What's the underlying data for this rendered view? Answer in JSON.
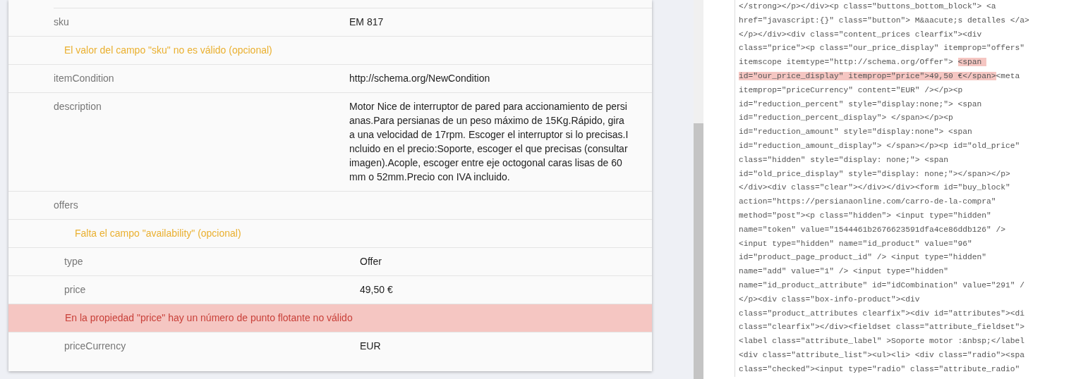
{
  "results": [
    {
      "kind": "property",
      "label": "sku",
      "value": "EM 817"
    },
    {
      "kind": "warning",
      "message": "El valor del campo \"sku\" no es válido (opcional)"
    },
    {
      "kind": "property",
      "label": "itemCondition",
      "value": "http://schema.org/NewCondition"
    },
    {
      "kind": "property",
      "label": "description",
      "value": "Motor Nice de interruptor de pared para accionamiento de persianas.Para persianas de un peso máximo de 15Kg.Rápido, gira a una velocidad de 17rpm. Escoger el interruptor si lo precisas.Incluido en el precio:Soporte, escoger el que precisas (consultar imagen).Acople, escoger entre eje octogonal caras lisas de 60mm o 52mm.Precio con IVA incluido."
    },
    {
      "kind": "property",
      "label": "offers",
      "children": [
        {
          "kind": "warning",
          "message": "Falta el campo \"availability\" (opcional)"
        },
        {
          "kind": "property",
          "label": "type",
          "value": "Offer"
        },
        {
          "kind": "property",
          "label": "price",
          "value": "49,50 €"
        },
        {
          "kind": "error",
          "message": "En la propiedad \"price\" hay un número de punto flotante no válido"
        },
        {
          "kind": "property",
          "label": "priceCurrency",
          "value": "EUR"
        }
      ]
    }
  ],
  "source_code": [
    [
      {
        "text": "</strong></p></div><p class=\"buttons_bottom_block\"> <a",
        "highlighted": false
      }
    ],
    [
      {
        "text": "href=\"javascript:{}\" class=\"button\"> M&aacute;s detalles </a>",
        "highlighted": false
      }
    ],
    [
      {
        "text": "</p></div><div class=\"content_prices clearfix\"><div",
        "highlighted": false
      }
    ],
    [
      {
        "text": "class=\"price\"><p class=\"our_price_display\" itemprop=\"offers\"",
        "highlighted": false
      }
    ],
    [
      {
        "text": "itemscope itemtype=\"http://schema.org/Offer\"> ",
        "highlighted": false
      },
      {
        "text": "<span ",
        "highlighted": true
      }
    ],
    [
      {
        "text": "id=\"our_price_display\" itemprop=\"price\">49,50 €</span>",
        "highlighted": true
      },
      {
        "text": "<meta",
        "highlighted": false
      }
    ],
    [
      {
        "text": "itemprop=\"priceCurrency\" content=\"EUR\" /></p><p",
        "highlighted": false
      }
    ],
    [
      {
        "text": "id=\"reduction_percent\" style=\"display:none;\"> <span",
        "highlighted": false
      }
    ],
    [
      {
        "text": "id=\"reduction_percent_display\"> </span></p><p",
        "highlighted": false
      }
    ],
    [
      {
        "text": "id=\"reduction_amount\" style=\"display:none\"> <span",
        "highlighted": false
      }
    ],
    [
      {
        "text": "id=\"reduction_amount_display\"> </span></p><p id=\"old_price\"",
        "highlighted": false
      }
    ],
    [
      {
        "text": "class=\"hidden\" style=\"display: none;\"> <span",
        "highlighted": false
      }
    ],
    [
      {
        "text": "id=\"old_price_display\" style=\"display: none;\"></span></p>",
        "highlighted": false
      }
    ],
    [
      {
        "text": "</div><div class=\"clear\"></div></div><form id=\"buy_block\"",
        "highlighted": false
      }
    ],
    [
      {
        "text": "action=\"https://persianaonline.com/carro-de-la-compra\"",
        "highlighted": false
      }
    ],
    [
      {
        "text": "method=\"post\"><p class=\"hidden\"> <input type=\"hidden\"",
        "highlighted": false
      }
    ],
    [
      {
        "text": "name=\"token\" value=\"1544461b2676623591dfa4ce86ddb126\" />",
        "highlighted": false
      }
    ],
    [
      {
        "text": "<input type=\"hidden\" name=\"id_product\" value=\"96\"",
        "highlighted": false
      }
    ],
    [
      {
        "text": "id=\"product_page_product_id\" /> <input type=\"hidden\"",
        "highlighted": false
      }
    ],
    [
      {
        "text": "name=\"add\" value=\"1\" /> <input type=\"hidden\"",
        "highlighted": false
      }
    ],
    [
      {
        "text": "name=\"id_product_attribute\" id=\"idCombination\" value=\"291\" /",
        "highlighted": false
      }
    ],
    [
      {
        "text": "</p><div class=\"box-info-product\"><div",
        "highlighted": false
      }
    ],
    [
      {
        "text": "class=\"product_attributes clearfix\"><div id=\"attributes\"><di",
        "highlighted": false
      }
    ],
    [
      {
        "text": "class=\"clearfix\"></div><fieldset class=\"attribute_fieldset\">",
        "highlighted": false
      }
    ],
    [
      {
        "text": "<label class=\"attribute_label\" >Soporte motor :&nbsp;</label",
        "highlighted": false
      }
    ],
    [
      {
        "text": "<div class=\"attribute_list\"><ul><li> <div class=\"radio\"><spa",
        "highlighted": false
      }
    ],
    [
      {
        "text": "class=\"checked\"><input type=\"radio\" class=\"attribute_radio\"",
        "highlighted": false
      }
    ]
  ]
}
